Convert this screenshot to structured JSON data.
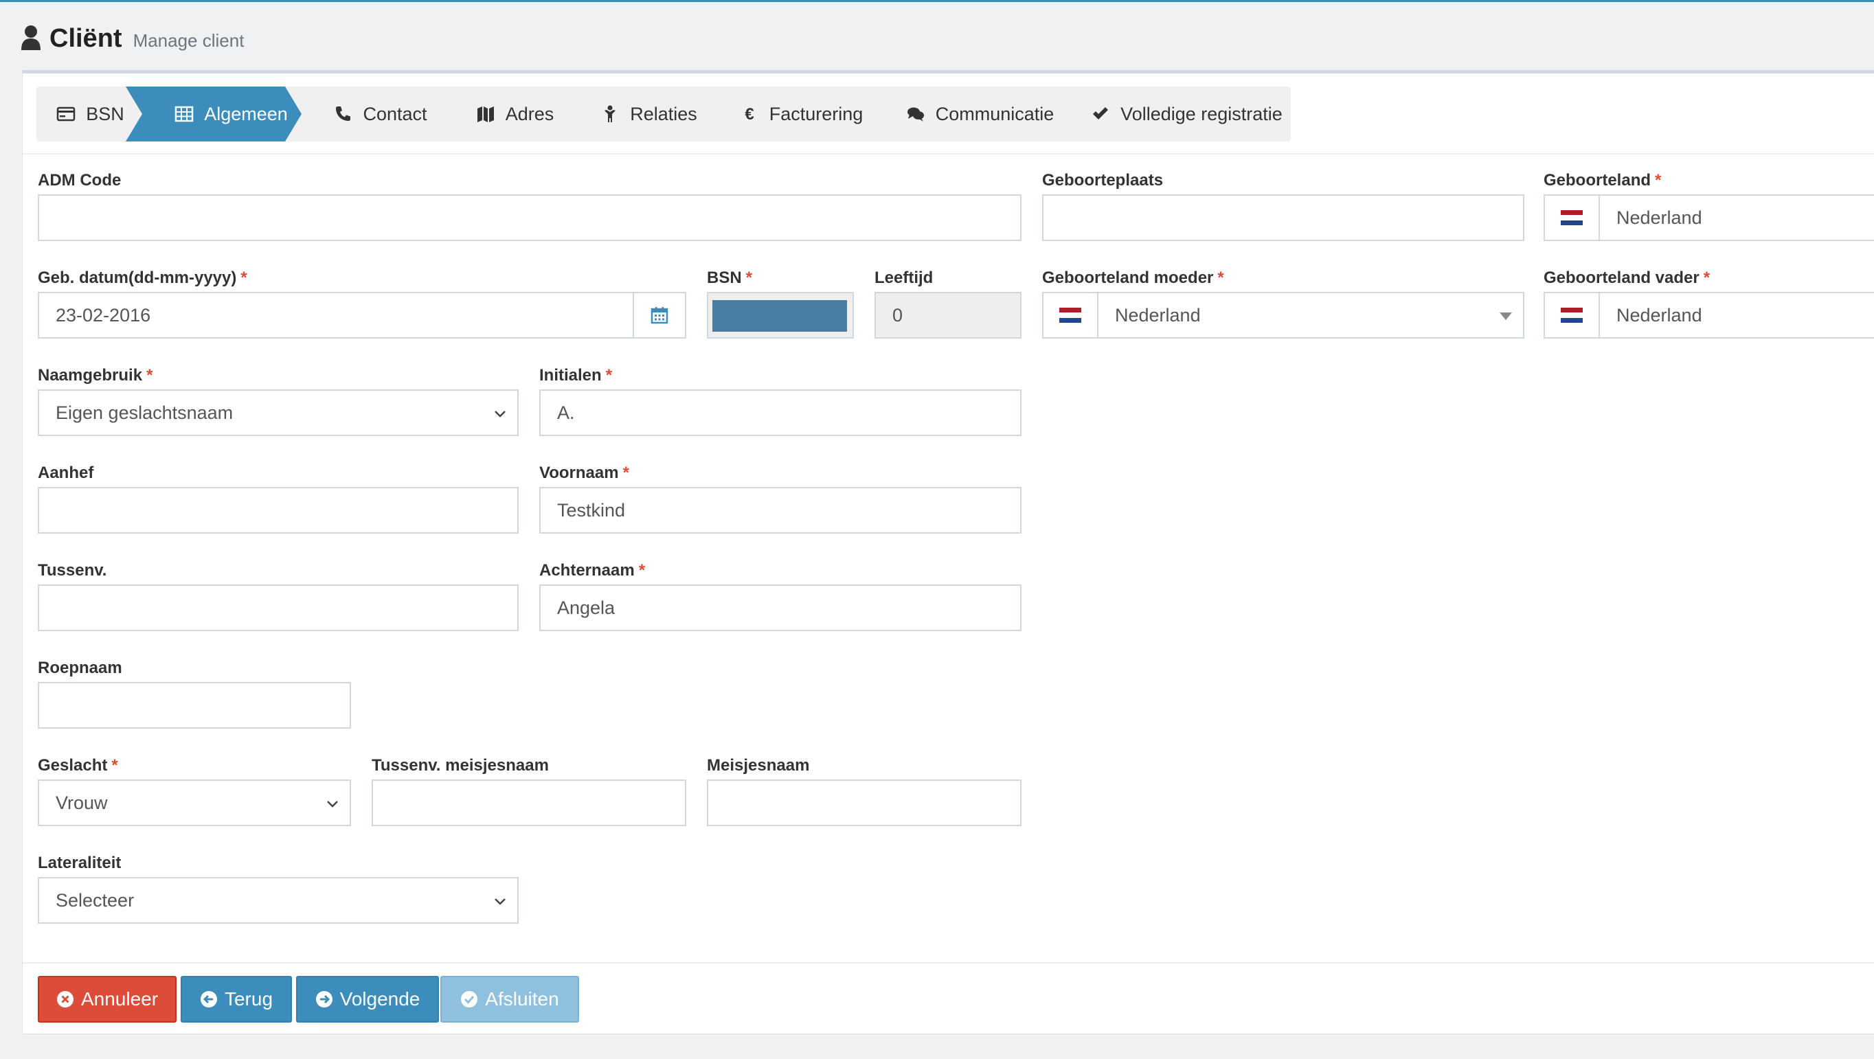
{
  "header": {
    "title": "Cliënt",
    "subtitle": "Manage client"
  },
  "steps": [
    {
      "label": "BSN",
      "icon": "id-card-icon"
    },
    {
      "label": "Algemeen",
      "icon": "table-icon",
      "active": true
    },
    {
      "label": "Contact",
      "icon": "phone-icon"
    },
    {
      "label": "Adres",
      "icon": "map-icon"
    },
    {
      "label": "Relaties",
      "icon": "child-icon"
    },
    {
      "label": "Facturering",
      "icon": "euro-icon"
    },
    {
      "label": "Communicatie",
      "icon": "comments-icon"
    },
    {
      "label": "Volledige registratie",
      "icon": "check-icon"
    }
  ],
  "form": {
    "adm_code": {
      "label": "ADM Code",
      "value": ""
    },
    "geboorteplaats": {
      "label": "Geboorteplaats",
      "value": ""
    },
    "geboorteland": {
      "label": "Geboorteland",
      "value": "Nederland"
    },
    "geb_datum": {
      "label": "Geb. datum(dd-mm-yyyy)",
      "value": "23-02-2016"
    },
    "bsn": {
      "label": "BSN",
      "value": ""
    },
    "leeftijd": {
      "label": "Leeftijd",
      "value": "0"
    },
    "geboorteland_moeder": {
      "label": "Geboorteland moeder",
      "value": "Nederland"
    },
    "geboorteland_vader": {
      "label": "Geboorteland vader",
      "value": "Nederland"
    },
    "naamgebruik": {
      "label": "Naamgebruik",
      "value": "Eigen geslachtsnaam"
    },
    "initialen": {
      "label": "Initialen",
      "value": "A."
    },
    "aanhef": {
      "label": "Aanhef",
      "value": ""
    },
    "voornaam": {
      "label": "Voornaam",
      "value": "Testkind"
    },
    "tussenv": {
      "label": "Tussenv.",
      "value": ""
    },
    "achternaam": {
      "label": "Achternaam",
      "value": "Angela"
    },
    "roepnaam": {
      "label": "Roepnaam",
      "value": ""
    },
    "geslacht": {
      "label": "Geslacht",
      "value": "Vrouw"
    },
    "tussenv_meisjesnaam": {
      "label": "Tussenv. meisjesnaam",
      "value": ""
    },
    "meisjesnaam": {
      "label": "Meisjesnaam",
      "value": ""
    },
    "lateraliteit": {
      "label": "Lateraliteit",
      "value": "Selecteer"
    },
    "required_mark": "*"
  },
  "buttons": {
    "annuleer": "Annuleer",
    "terug": "Terug",
    "volgende": "Volgende",
    "afsluiten": "Afsluiten"
  },
  "colors": {
    "primary": "#3c8dbc",
    "danger": "#dd4b39",
    "disabled": "#8fc0dd",
    "flag_red": "#ae1c28",
    "flag_white": "#ffffff",
    "flag_blue": "#21468b"
  }
}
